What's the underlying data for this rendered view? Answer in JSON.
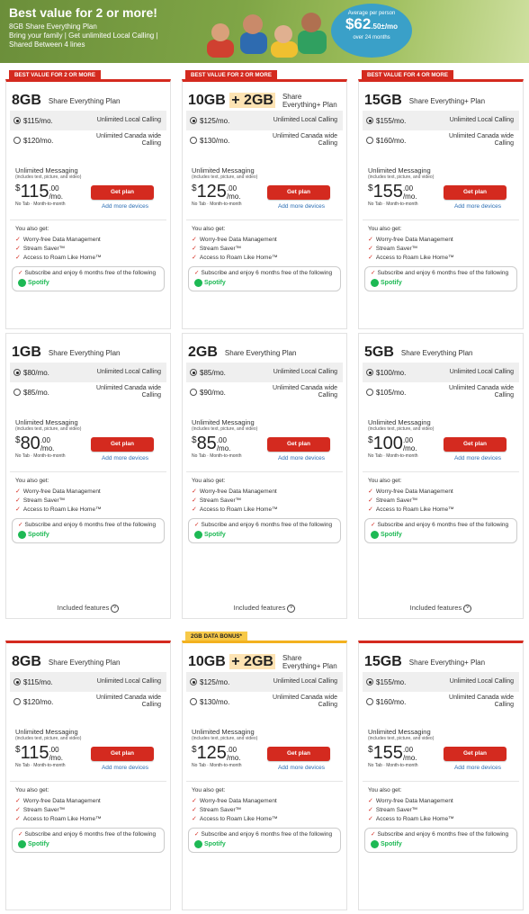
{
  "banner": {
    "title": "Best value for 2 or more!",
    "lines": [
      "8GB Share Everything Plan",
      "Bring your family | Get unlimited Local Calling |",
      "Shared Between 4 lines"
    ],
    "badge": {
      "label": "Average per person",
      "price": "$62",
      "cents": ".50±/mo",
      "term": "over 24 months"
    }
  },
  "colors": {
    "accent": "#d42a1f",
    "link": "#2a6db3",
    "bonus": "#f7c948",
    "spotify": "#1db954"
  },
  "common": {
    "messaging_title": "Unlimited Messaging",
    "messaging_sup": "1",
    "messaging_sub": "(includes text, picture, and video)",
    "fine": "No Tab · Month-to-month",
    "get_plan": "Get plan",
    "add_more": "Add more devices",
    "also_title": "You also get:",
    "features": [
      "Worry-free Data Management",
      "Stream Saver™",
      "Access to Roam Like Home™"
    ],
    "promo_text": "Subscribe and enjoy 6 months free of the following",
    "promo_sup": "11",
    "spotify": "Spotify",
    "included": "Included features",
    "opt1_desc": "Unlimited Local Calling",
    "opt2_desc": "Unlimited Canada wide Calling",
    "per_mo": "/mo."
  },
  "cards": [
    {
      "tag": "BEST VALUE FOR 2 OR MORE",
      "size": "8GB",
      "extra": "",
      "name": "Share Everything Plan",
      "p1": "$115/mo.",
      "p2": "$120/mo.",
      "price": "115",
      "cents": ".00"
    },
    {
      "tag": "BEST VALUE FOR 2 OR MORE",
      "size": "10GB",
      "extra": "+ 2GB",
      "name": "Share Everything+ Plan",
      "p1": "$125/mo.",
      "p2": "$130/mo.",
      "price": "125",
      "cents": ".00"
    },
    {
      "tag": "BEST VALUE FOR 4 OR MORE",
      "size": "15GB",
      "extra": "",
      "name": "Share Everything+ Plan",
      "p1": "$155/mo.",
      "p2": "$160/mo.",
      "price": "155",
      "cents": ".00"
    },
    {
      "tag": "",
      "size": "1GB",
      "extra": "",
      "name": "Share Everything Plan",
      "p1": "$80/mo.",
      "p2": "$85/mo.",
      "price": "80",
      "cents": ".00"
    },
    {
      "tag": "",
      "size": "2GB",
      "extra": "",
      "name": "Share Everything Plan",
      "p1": "$85/mo.",
      "p2": "$90/mo.",
      "price": "85",
      "cents": ".00"
    },
    {
      "tag": "",
      "size": "5GB",
      "extra": "",
      "name": "Share Everything Plan",
      "p1": "$100/mo.",
      "p2": "$105/mo.",
      "price": "100",
      "cents": ".00"
    },
    {
      "tag": "",
      "size": "8GB",
      "extra": "",
      "name": "Share Everything Plan",
      "p1": "$115/mo.",
      "p2": "$120/mo.",
      "price": "115",
      "cents": ".00"
    },
    {
      "tag": "2GB DATA BONUS*",
      "size": "10GB",
      "extra": "+ 2GB",
      "name": "Share Everything+ Plan",
      "p1": "$125/mo.",
      "p2": "$130/mo.",
      "price": "125",
      "cents": ".00"
    },
    {
      "tag": "",
      "size": "15GB",
      "extra": "",
      "name": "Share Everything+ Plan",
      "p1": "$155/mo.",
      "p2": "$160/mo.",
      "price": "155",
      "cents": ".00"
    }
  ]
}
